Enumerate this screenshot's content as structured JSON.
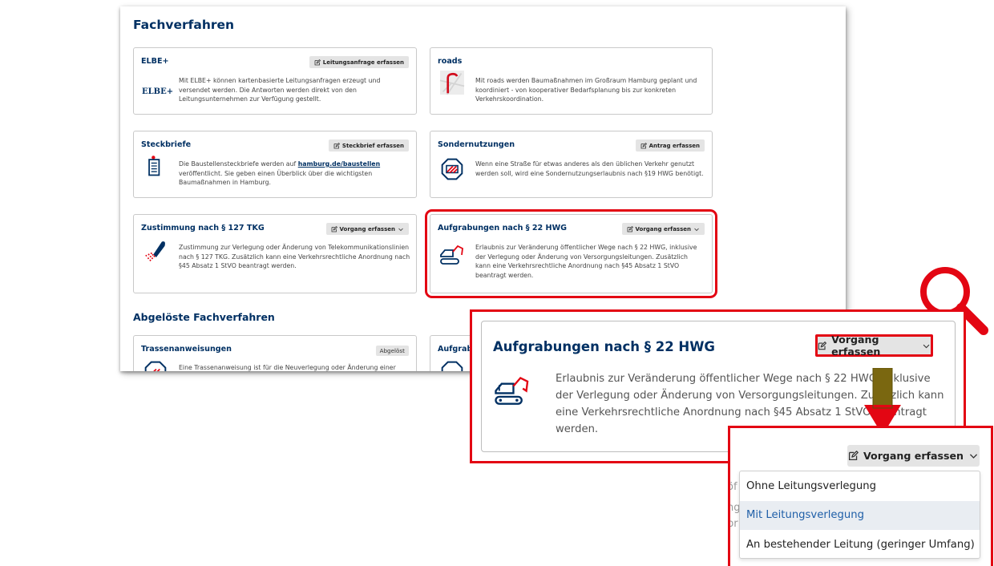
{
  "main": {
    "section_title": "Fachverfahren",
    "section2_title": "Abgelöste Fachverfahren",
    "cards": [
      {
        "title": "ELBE+",
        "button": "Leitungsanfrage erfassen",
        "icon": "elbe-logo-icon",
        "logo_text": "ELBE+",
        "text": "Mit ELBE+ können kartenbasierte Leitungsanfragen erzeugt und versendet werden. Die Antworten werden direkt von den Leitungsunternehmen zur Verfügung gestellt."
      },
      {
        "title": "roads",
        "icon": "roads-logo-icon",
        "text": "Mit roads werden Baumaßnahmen im Großraum Hamburg geplant und koordiniert - von kooperativer Bedarfsplanung bis zur konkreten Verkehrskoordination."
      },
      {
        "title": "Steckbriefe",
        "button": "Steckbrief erfassen",
        "icon": "signboard-icon",
        "text_before": "Die Baustellensteckbriefe werden auf ",
        "link": "hamburg.de/baustellen",
        "text_after": " veröffentlicht. Sie geben einen Überblick über die wichtigsten Baumaßnahmen in Hamburg."
      },
      {
        "title": "Sondernutzungen",
        "button": "Antrag erfassen",
        "icon": "road-sign-icon",
        "text": "Wenn eine Straße für etwas anderes als den üblichen Verkehr genutzt werden soll, wird eine Sondernutzungserlaubnis nach §19 HWG benötigt."
      },
      {
        "title": "Zustimmung nach § 127 TKG",
        "button": "Vorgang erfassen",
        "icon": "fiber-cable-icon",
        "text": "Zustimmung zur Verlegung oder Änderung von Telekommunikationslinien nach § 127 TKG. Zusätzlich kann eine Verkehrsrechtliche Anordnung nach §45 Absatz 1 StVO beantragt werden."
      },
      {
        "title": "Aufgrabungen nach § 22 HWG",
        "button": "Vorgang erfassen",
        "icon": "excavator-icon",
        "text": "Erlaubnis zur Veränderung öffentlicher Wege nach § 22 HWG, inklusive der Verlegung oder Änderung von Versorgungsleitungen. Zusätzlich kann eine Verkehrsrechtliche Anordnung nach §45 Absatz 1 StVO beantragt werden."
      }
    ],
    "old_cards": [
      {
        "title": "Trassenanweisungen",
        "tag": "Abgelöst",
        "icon": "road-sign-icon",
        "text": "Eine Trassenanweisung ist für die Neuverlegung oder Änderung einer"
      },
      {
        "title": "Aufgrab",
        "icon": "road-sign-icon"
      }
    ]
  },
  "zoom": {
    "title": "Aufgrabungen nach § 22 HWG",
    "button": "Vorgang erfassen",
    "text": "Erlaubnis zur Veränderung öffentlicher Wege nach § 22 HWG, inklusive der Verlegung oder Änderung von Versorgungsleitungen. Zusätzlich kann eine Verkehrsrechtliche Anordnung nach §45 Absatz 1 StVO beantragt werden."
  },
  "dropdown": {
    "button": "Vorgang erfassen",
    "ghost_text": [
      "öf",
      "ng",
      "br"
    ],
    "options": [
      "Ohne Leitungsverlegung",
      "Mit Leitungsverlegung",
      "An bestehender Leitung (geringer Umfang)"
    ],
    "active_index": 1
  },
  "icons": [
    "magnifier-icon",
    "down-arrow-icon",
    "edit-icon",
    "chevron-down-icon"
  ],
  "colors": {
    "accent_red": "#e30613",
    "heading_blue": "#003063",
    "arrow_green": "#6b5d12",
    "link_blue": "#1f5fa8"
  }
}
